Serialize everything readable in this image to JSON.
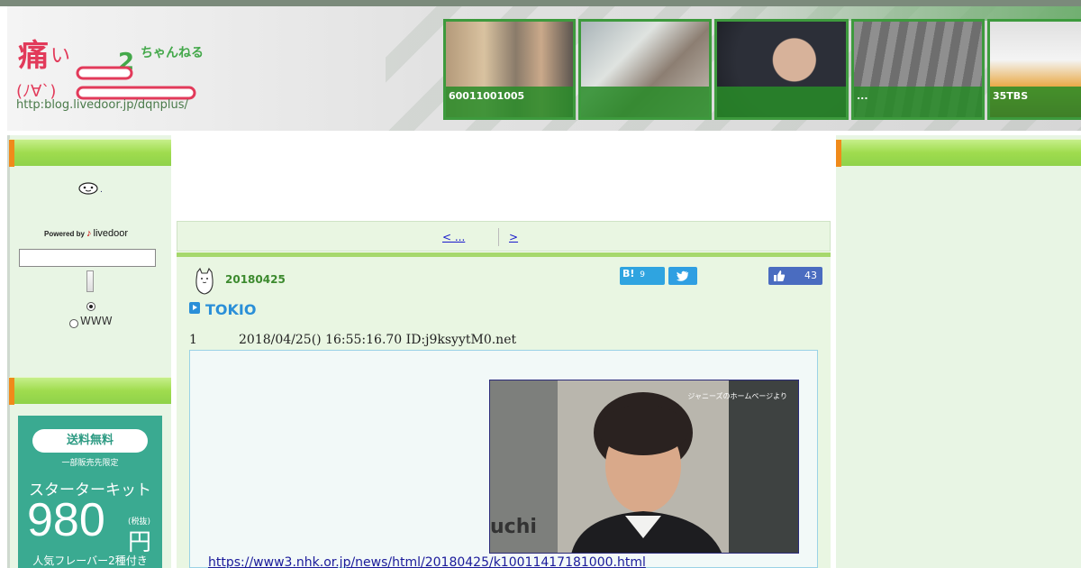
{
  "header": {
    "logo_url": "http:blog.livedoor.jp/dqnplus/",
    "thumbnails": [
      {
        "caption": "60011001005"
      },
      {
        "caption": ""
      },
      {
        "caption": ""
      },
      {
        "caption": "..."
      },
      {
        "caption": "35TBS"
      }
    ]
  },
  "sidebar": {
    "powered_by": "Powered by",
    "provider": "livedoor",
    "search_value": "",
    "radio_www": "WWW",
    "ad": {
      "pill": "送料無料",
      "sub": "一部販売先限定",
      "title": "スターターキット",
      "price": "980",
      "tax": "(税抜)",
      "yen": "円",
      "foot": "人気フレーバー2種付き"
    }
  },
  "nav": {
    "prev": "< ...",
    "next": ">"
  },
  "post": {
    "date": "20180425",
    "hatena_count": "9",
    "hatena_label": "B!",
    "like_count": "43",
    "title": "TOKIO",
    "res_number": "1",
    "res_meta": "2018/04/25() 16:55:16.70 ID:j9ksyytM0.net",
    "photo_caption": "ジャニーズのホームページより",
    "photo_watermark": "uchi",
    "source_link": "https://www3.nhk.or.jp/news/html/20180425/k10011417181000.html"
  },
  "colors": {
    "accent_green": "#9fdc4e",
    "link_blue": "#1a1acc",
    "title_blue": "#2a8fd8"
  }
}
